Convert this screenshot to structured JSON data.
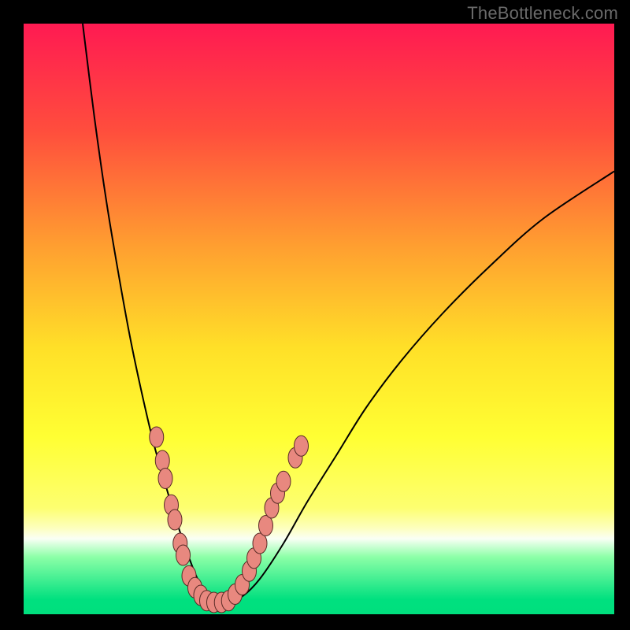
{
  "watermark": "TheBottleneck.com",
  "colors": {
    "background": "#000000",
    "curve_stroke": "#000000",
    "marker_fill": "#e8887f",
    "marker_stroke": "#5a2c27"
  },
  "chart_data": {
    "type": "line",
    "title": "",
    "xlabel": "",
    "ylabel": "",
    "xlim": [
      0,
      100
    ],
    "ylim": [
      0,
      100
    ],
    "gradient_stops": [
      {
        "offset": 0.0,
        "color": "#ff1a52"
      },
      {
        "offset": 0.18,
        "color": "#ff4d3d"
      },
      {
        "offset": 0.38,
        "color": "#ffa030"
      },
      {
        "offset": 0.55,
        "color": "#ffe028"
      },
      {
        "offset": 0.7,
        "color": "#ffff33"
      },
      {
        "offset": 0.82,
        "color": "#fdff70"
      },
      {
        "offset": 0.855,
        "color": "#fdffc0"
      },
      {
        "offset": 0.872,
        "color": "#fafff5"
      },
      {
        "offset": 0.903,
        "color": "#8cffa7"
      },
      {
        "offset": 0.975,
        "color": "#00e07f"
      },
      {
        "offset": 1.0,
        "color": "#00df7e"
      }
    ],
    "series": [
      {
        "name": "bottleneck-curve",
        "x": [
          10,
          12,
          14,
          16,
          18,
          20,
          22,
          24,
          25.8,
          27.5,
          29,
          30.5,
          32.5,
          34.5,
          37,
          40,
          44,
          48,
          53,
          58,
          64,
          71,
          79,
          88,
          100
        ],
        "y": [
          100,
          84,
          70,
          58,
          47,
          37.5,
          29,
          22,
          16,
          11,
          7,
          4,
          2,
          2,
          3,
          6,
          12,
          19,
          27,
          35,
          43,
          51,
          59,
          67,
          75
        ]
      }
    ],
    "markers": [
      {
        "x": 22.5,
        "y": 30
      },
      {
        "x": 23.5,
        "y": 26
      },
      {
        "x": 24.0,
        "y": 23
      },
      {
        "x": 25.0,
        "y": 18.5
      },
      {
        "x": 25.6,
        "y": 16
      },
      {
        "x": 26.5,
        "y": 12
      },
      {
        "x": 27.0,
        "y": 10
      },
      {
        "x": 28.0,
        "y": 6.5
      },
      {
        "x": 29.0,
        "y": 4.5
      },
      {
        "x": 30.0,
        "y": 3.2
      },
      {
        "x": 31.0,
        "y": 2.3
      },
      {
        "x": 32.2,
        "y": 2.0
      },
      {
        "x": 33.5,
        "y": 2.0
      },
      {
        "x": 34.7,
        "y": 2.3
      },
      {
        "x": 35.8,
        "y": 3.4
      },
      {
        "x": 37.0,
        "y": 5.0
      },
      {
        "x": 38.2,
        "y": 7.3
      },
      {
        "x": 39.0,
        "y": 9.5
      },
      {
        "x": 40.0,
        "y": 12
      },
      {
        "x": 41.0,
        "y": 15
      },
      {
        "x": 42.0,
        "y": 18
      },
      {
        "x": 43.0,
        "y": 20.5
      },
      {
        "x": 44.0,
        "y": 22.5
      },
      {
        "x": 46.0,
        "y": 26.5
      },
      {
        "x": 47.0,
        "y": 28.5
      }
    ]
  }
}
